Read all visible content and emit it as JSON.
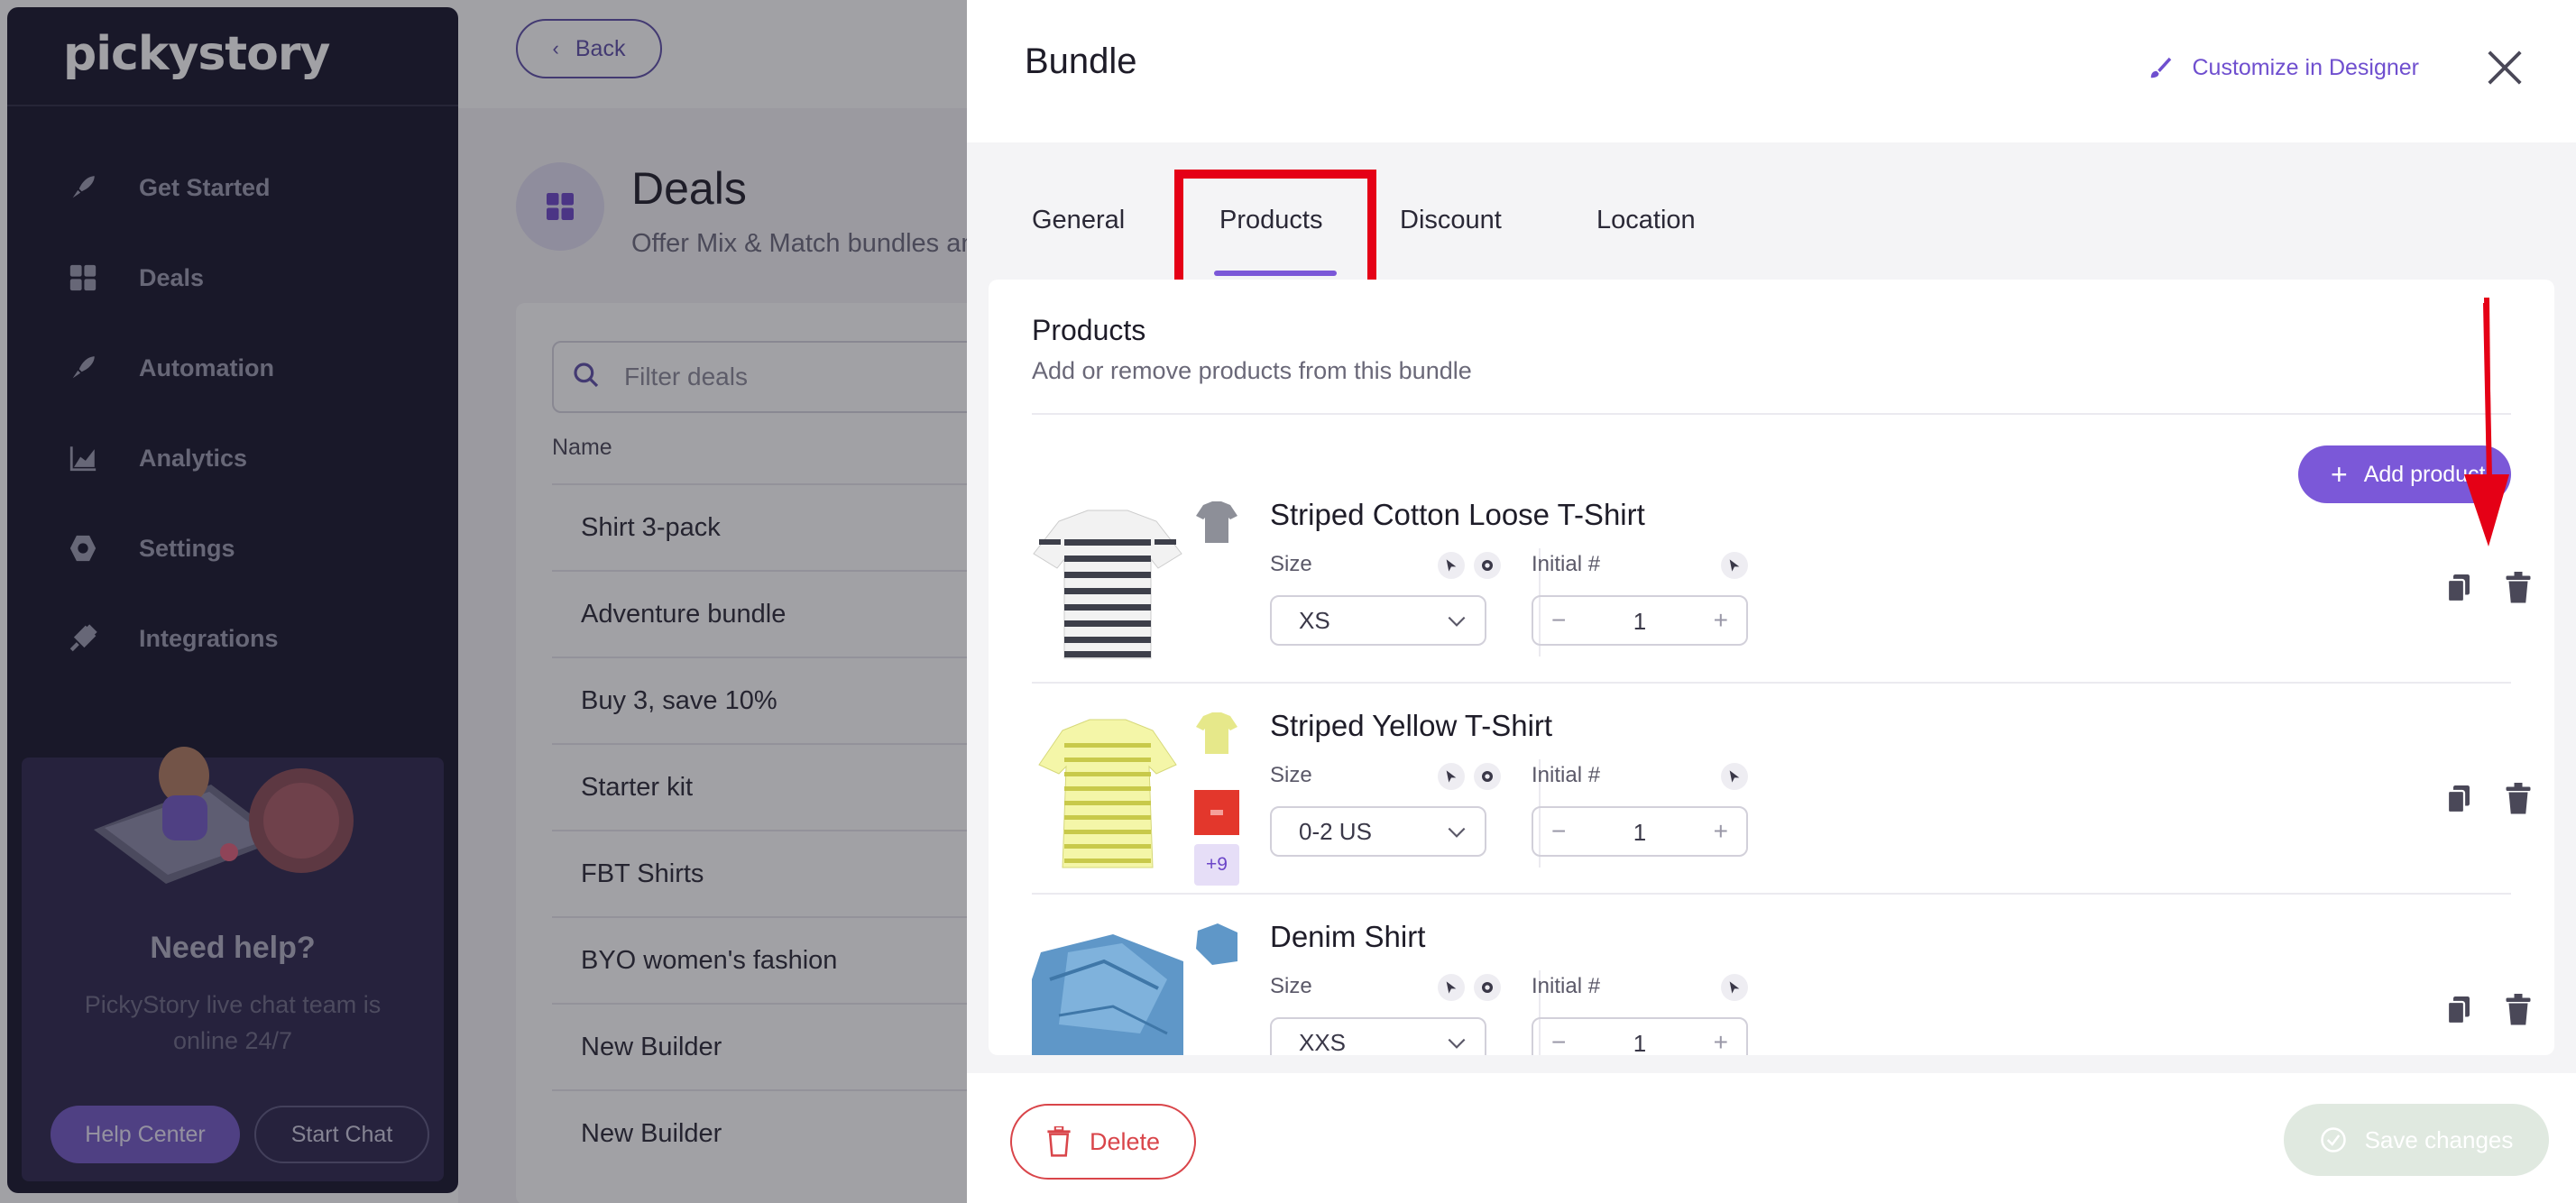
{
  "sidebar": {
    "logo": "pickystory",
    "items": [
      {
        "label": "Get Started",
        "icon": "rocket-icon"
      },
      {
        "label": "Deals",
        "icon": "grid-icon"
      },
      {
        "label": "Automation",
        "icon": "rocket-icon"
      },
      {
        "label": "Analytics",
        "icon": "chart-icon"
      },
      {
        "label": "Settings",
        "icon": "gear-icon"
      },
      {
        "label": "Integrations",
        "icon": "plug-icon"
      }
    ],
    "help": {
      "title": "Need help?",
      "subtitle": "PickyStory live chat team is online 24/7",
      "help_center": "Help Center",
      "start_chat": "Start Chat"
    }
  },
  "background": {
    "back_label": "Back",
    "title": "Deals",
    "subtitle": "Offer Mix & Match bundles and",
    "filter_placeholder": "Filter deals",
    "column_name": "Name",
    "deals": [
      "Shirt 3-pack",
      "Adventure bundle",
      "Buy 3, save 10%",
      "Starter kit",
      "FBT Shirts",
      "BYO women's fashion",
      "New Builder",
      "New Builder"
    ]
  },
  "drawer": {
    "title": "Bundle",
    "customize_label": "Customize in Designer",
    "tabs": [
      "General",
      "Products",
      "Discount",
      "Location"
    ],
    "active_tab": "Products",
    "section_title": "Products",
    "section_subtitle": "Add or remove products from this bundle",
    "add_product": "Add product",
    "products": [
      {
        "name": "Striped Cotton Loose T-Shirt",
        "option_label": "Size",
        "option_value": "XS",
        "qty_label": "Initial #",
        "qty": "1"
      },
      {
        "name": "Striped Yellow T-Shirt",
        "option_label": "Size",
        "option_value": "0-2 US",
        "qty_label": "Initial #",
        "qty": "1",
        "more_variants": "+9"
      },
      {
        "name": "Denim Shirt",
        "option_label": "Size",
        "option_value": "XXS",
        "qty_label": "Initial #",
        "qty": "1"
      }
    ],
    "delete_label": "Delete",
    "save_label": "Save changes"
  },
  "colors": {
    "accent": "#7b58d8",
    "sidebar_bg": "#15132a",
    "highlight": "#e50016",
    "danger": "#d9454a"
  }
}
